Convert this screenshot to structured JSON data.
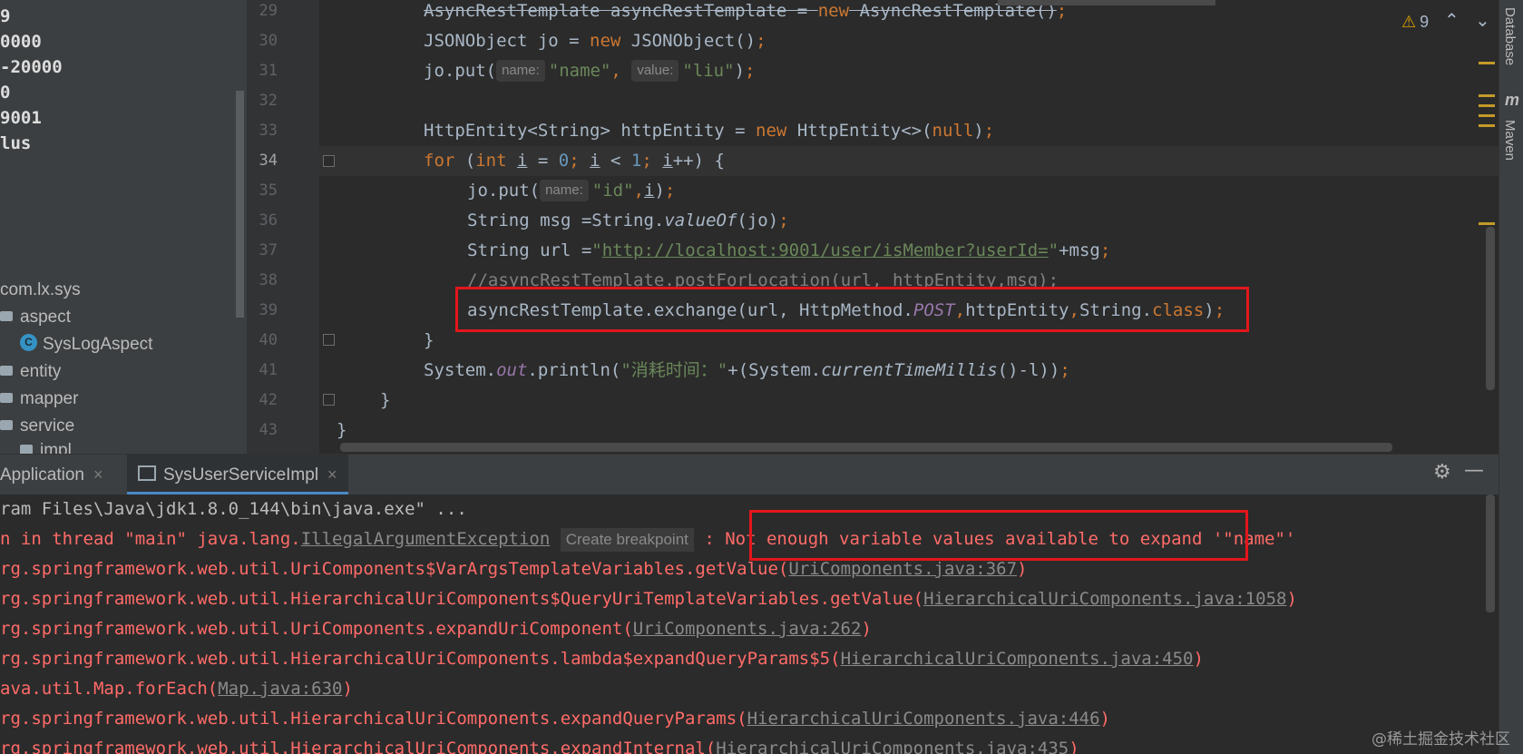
{
  "tree": {
    "rows": [
      "9",
      "0000",
      "-20000",
      "0",
      "9001",
      "lus"
    ],
    "package": "com.lx.sys",
    "folders": [
      "aspect",
      "entity",
      "mapper",
      "service",
      "impl"
    ],
    "class_item": "SysLogAspect",
    "class_badge": "C"
  },
  "editor": {
    "line_numbers": [
      "29",
      "30",
      "31",
      "32",
      "33",
      "34",
      "35",
      "36",
      "37",
      "38",
      "39",
      "40",
      "41",
      "42",
      "43"
    ],
    "l29a": "AsyncRestTemplate asyncRestTemplate = ",
    "l29k": "new",
    "l29b": " AsyncRestTemplate()",
    "l30a": "JSONObject jo = ",
    "l30k": "new",
    "l30b": " JSONObject()",
    "l31a": "jo.put(",
    "hint_name": "name:",
    "l31s1": "\"name\"",
    "hint_value": "value:",
    "l31s2": "\"liu\"",
    "l31b": ")",
    "l33a": "HttpEntity<String> httpEntity = ",
    "l33k": "new",
    "l33b": " HttpEntity<>(",
    "l33null": "null",
    "l33c": ")",
    "l34for": "for",
    "l34a": " (",
    "l34int": "int",
    "l34i1": "i",
    "l34eq": " = ",
    "l34n0": "0",
    "l34i2": "i",
    "l34lt": " < ",
    "l34n1": "1",
    "l34i3": "i",
    "l34b": "++) {",
    "l35a": "jo.put(",
    "l35s": "\"id\"",
    "l35i": "i",
    "l35b": ")",
    "l36a": "String msg =String.",
    "l36m": "valueOf",
    "l36b": "(jo)",
    "l37a": "String url =",
    "l37q": "\"",
    "l37url": "http://localhost:9001/user/isMember?userId=",
    "l37b": "+msg",
    "l38": "//asyncRestTemplate.postForLocation(url, httpEntity,msg);",
    "l39a": "asyncRestTemplate.exchange(url, HttpMethod.",
    "l39post": "POST",
    "l39b": "httpEntity",
    "l39c": "String.",
    "l39class": "class",
    "l39d": ")",
    "l40": "}",
    "l41a": "System.",
    "l41out": "out",
    "l41b": ".println(",
    "l41s": "\"消耗时间：\"",
    "l41c": "+(System.",
    "l41m": "currentTimeMillis",
    "l41d": "()-l))",
    "l42": "}",
    "l43": "}",
    "semi": ";",
    "comma": ",",
    "warnings": "9"
  },
  "right_strip": {
    "database": "Database",
    "maven": "Maven",
    "maven_icon": "m"
  },
  "run": {
    "tabs": [
      "Application",
      "SysUserServiceImpl"
    ],
    "close": "×"
  },
  "console": {
    "line1": "ram Files\\Java\\jdk1.8.0_144\\bin\\java.exe\" ...",
    "l2a": "n in thread \"main\" java.lang.",
    "l2exc": "IllegalArgumentException",
    "l2bp": "Create breakpoint",
    "l2b": " : Not enough variable values available to expand '\"name\"'",
    "frames": [
      {
        "pre": "rg.springframework.web.util.UriComponents$VarArgsTemplateVariables.getValue(",
        "link": "UriComponents.java:367",
        "post": ")"
      },
      {
        "pre": "rg.springframework.web.util.HierarchicalUriComponents$QueryUriTemplateVariables.getValue(",
        "link": "HierarchicalUriComponents.java:1058",
        "post": ")"
      },
      {
        "pre": "rg.springframework.web.util.UriComponents.expandUriComponent(",
        "link": "UriComponents.java:262",
        "post": ")"
      },
      {
        "pre": "rg.springframework.web.util.HierarchicalUriComponents.lambda$expandQueryParams$5(",
        "link": "HierarchicalUriComponents.java:450",
        "post": ")"
      },
      {
        "pre": "ava.util.Map.forEach(",
        "link": "Map.java:630",
        "post": ")"
      },
      {
        "pre": "rg.springframework.web.util.HierarchicalUriComponents.expandQueryParams(",
        "link": "HierarchicalUriComponents.java:446",
        "post": ")"
      },
      {
        "pre": "rg.springframework.web.util.HierarchicalUriComponents.expandInternal(",
        "link": "HierarchicalUriComponents.java:435",
        "post": ")"
      }
    ]
  },
  "watermark": "@稀土掘金技术社区",
  "colors": {
    "error": "#ff6b68",
    "keyword": "#cc7832",
    "string": "#6a8759",
    "number": "#6897bb",
    "highlight_box": "#e3161b"
  }
}
